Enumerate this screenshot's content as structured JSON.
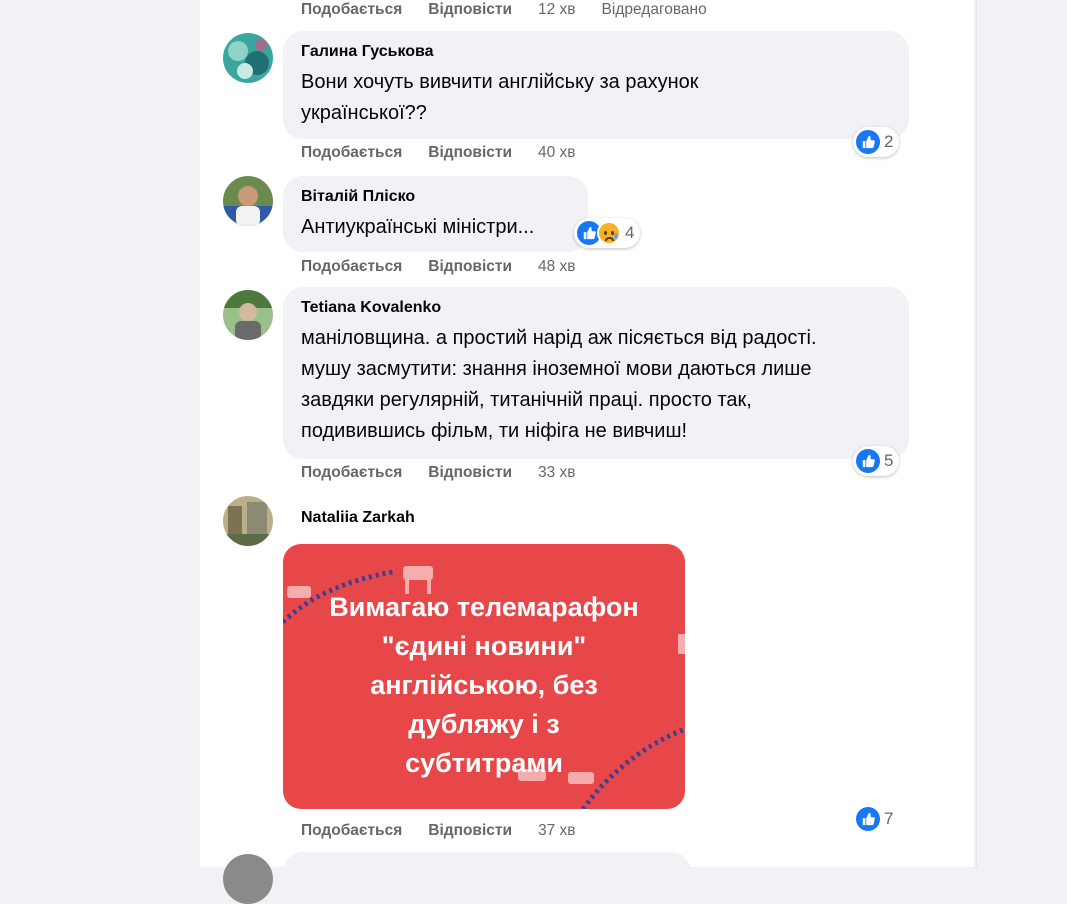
{
  "top_actions": {
    "like": "Подобається",
    "reply": "Відповісти",
    "time": "12 хв",
    "edited": "Відредаговано"
  },
  "comments": [
    {
      "author": "Галина Гуськова",
      "lines": [
        "Вони хочуть вивчити англійську за рахунок",
        "української??"
      ],
      "reactions": {
        "like_count": "2"
      },
      "actions": {
        "like": "Подобається",
        "reply": "Відповісти",
        "time": "40 хв"
      }
    },
    {
      "author": "Віталій Пліско",
      "lines": [
        "Антиукраїнські міністри..."
      ],
      "reactions": {
        "like_count": "4",
        "icons": [
          "like-icon",
          "sad-icon"
        ]
      },
      "actions": {
        "like": "Подобається",
        "reply": "Відповісти",
        "time": "48 хв"
      }
    },
    {
      "author": "Tetiana Kovalenko",
      "lines": [
        "маніловщина. а простий нарід аж пісяється від радості.",
        "мушу засмутити: знання іноземної мови даються лише",
        "завдяки регулярній, титанічній праці. просто так,",
        "подивившись фільм, ти ніфіга не вивчиш!"
      ],
      "reactions": {
        "like_count": "5"
      },
      "actions": {
        "like": "Подобається",
        "reply": "Відповісти",
        "time": "33 хв"
      }
    },
    {
      "author": "Nataliia Zarkah",
      "image_caption": [
        "Вимагаю телемарафон",
        "\"єдині новини\"",
        "англійською, без",
        "дубляжу і з",
        "субтитрами"
      ],
      "reactions": {
        "like_count": "7"
      },
      "actions": {
        "like": "Подобається",
        "reply": "Відповісти",
        "time": "37 хв"
      }
    }
  ],
  "colors": {
    "accent": "#1877f2",
    "bubble": "#f0f2f5",
    "meme_bg": "#e8474a",
    "muted_text": "#65676b"
  }
}
